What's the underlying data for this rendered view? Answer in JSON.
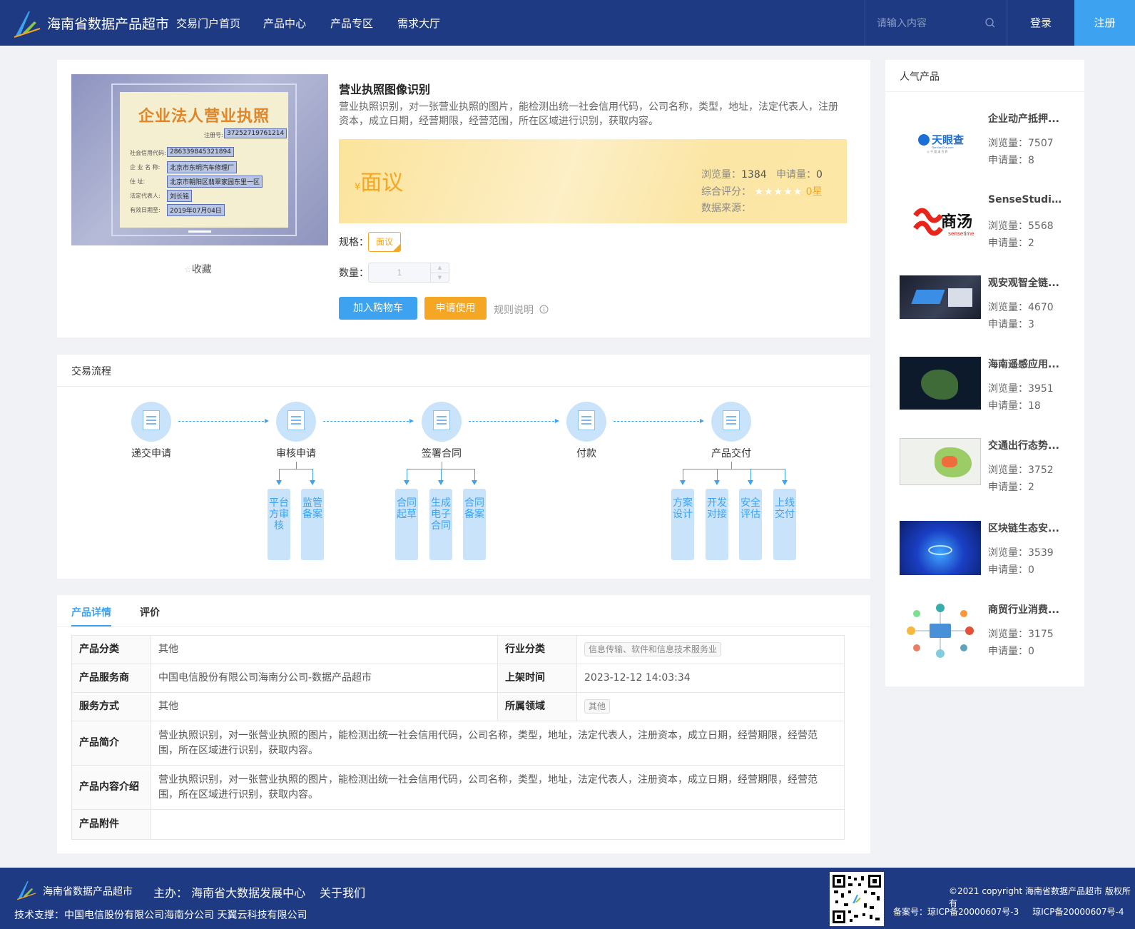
{
  "header": {
    "site_title": "海南省数据产品超市",
    "nav": [
      "交易门户首页",
      "产品中心",
      "产品专区",
      "需求大厅"
    ],
    "search_placeholder": "请输入内容",
    "login": "登录",
    "register": "注册"
  },
  "product": {
    "image": {
      "title": "企业法人营业执照",
      "reg_label": "注册号:",
      "reg_no": "37252719761214",
      "fields": [
        {
          "label": "社会信用代码:",
          "value": "286339845321894"
        },
        {
          "label": "企 业 名 称:",
          "value": "北京市东明汽车修理厂"
        },
        {
          "label": "住     址:",
          "value": "北京市朝阳区翡翠家园东里一区"
        },
        {
          "label": "法定代表人:",
          "value": "刘长铭"
        },
        {
          "label": "有效日期至:",
          "value": "2019年07月04日"
        }
      ]
    },
    "favorite": "收藏",
    "title": "营业执照图像识别",
    "description": "营业执照识别，对一张营业执照的图片，能检测出统一社会信用代码，公司名称，类型，地址，法定代表人，注册资本，成立日期，经营期限，经营范围，所在区域进行识别，获取内容。",
    "price_symbol": "¥",
    "price": "面议",
    "views_label": "浏览量：",
    "views": "1384",
    "applies_label": "申请量：",
    "applies": "0",
    "rating_label": "综合评分：",
    "stars": "★★★★★",
    "rating": "0星",
    "source_label": "数据来源：",
    "spec_label": "规格：",
    "spec_value": "面议",
    "qty_label": "数量：",
    "qty_value": "1",
    "add_cart": "加入购物车",
    "apply": "申请使用",
    "rules": "规则说明"
  },
  "flow": {
    "title": "交易流程",
    "steps": [
      "递交申请",
      "审核申请",
      "签署合同",
      "付款",
      "产品交付"
    ],
    "subs": [
      "平台方审核",
      "监管备案",
      "合同起草",
      "生成电子合同",
      "合同备案",
      "方案设计",
      "开发对接",
      "安全评估",
      "上线交付"
    ]
  },
  "tabs": [
    "产品详情",
    "评价"
  ],
  "detail": {
    "category_label": "产品分类",
    "category": "其他",
    "industry_label": "行业分类",
    "industry": "信息传输、软件和信息技术服务业",
    "provider_label": "产品服务商",
    "provider": "中国电信股份有限公司海南分公司-数据产品超市",
    "listed_label": "上架时间",
    "listed": "2023-12-12 14:03:34",
    "service_label": "服务方式",
    "service": "其他",
    "domain_label": "所属领域",
    "domain": "其他",
    "intro_label": "产品简介",
    "intro": "营业执照识别，对一张营业执照的图片，能检测出统一社会信用代码，公司名称，类型，地址，法定代表人，注册资本，成立日期，经营期限，经营范围，所在区域进行识别，获取内容。",
    "content_label": "产品内容介绍",
    "content": "营业执照识别，对一张营业执照的图片，能检测出统一社会信用代码，公司名称，类型，地址，法定代表人，注册资本，成立日期，经营期限，经营范围，所在区域进行识别，获取内容。",
    "attach_label": "产品附件"
  },
  "sidebar": {
    "title": "人气产品",
    "views_label": "浏览量：",
    "applies_label": "申请量：",
    "items": [
      {
        "title": "企业动产抵押...",
        "views": "7507",
        "applies": "8",
        "logo_text": "天眼查",
        "logo_sub": "TianYanCha.com",
        "logo_tag": "公 平 看 清 世 界"
      },
      {
        "title": "SenseStudio...",
        "views": "5568",
        "applies": "2",
        "logo_text": "商汤",
        "logo_sub": "sensetime"
      },
      {
        "title": "观安观智全链...",
        "views": "4670",
        "applies": "3"
      },
      {
        "title": "海南遥感应用...",
        "views": "3951",
        "applies": "18"
      },
      {
        "title": "交通出行态势...",
        "views": "3752",
        "applies": "2"
      },
      {
        "title": "区块链生态安...",
        "views": "3539",
        "applies": "0"
      },
      {
        "title": "商贸行业消费...",
        "views": "3175",
        "applies": "0"
      }
    ]
  },
  "footer": {
    "site": "海南省数据产品超市",
    "host": "主办： 海南省大数据发展中心",
    "about": "关于我们",
    "tech": "技术支撑：中国电信股份有限公司海南分公司    天翼云科技有限公司",
    "copyright": "©2021 copyright 海南省数据产品超市 版权所有",
    "icp": "备案号：琼ICP备20000607号-3     琼ICP备20000607号-4"
  }
}
